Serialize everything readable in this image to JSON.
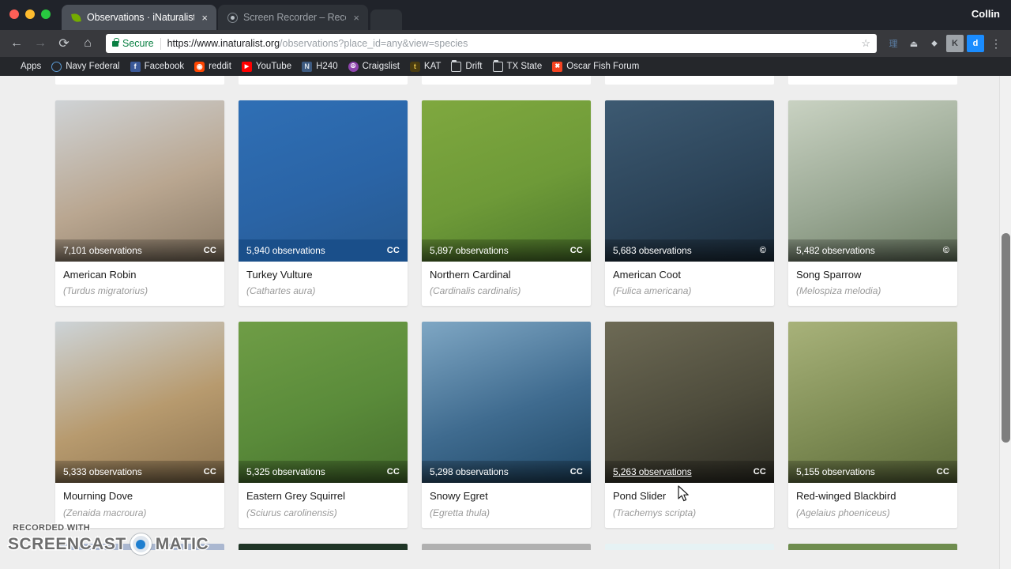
{
  "browser": {
    "tabs": [
      {
        "title": "Observations · iNaturalist.org",
        "favicon": "leaf-icon",
        "close": "×",
        "active": true
      },
      {
        "title": "Screen Recorder – Record you",
        "favicon": "record-icon",
        "close": "×",
        "active": false
      }
    ],
    "user": "Collin",
    "nav": {
      "back": "←",
      "forward": "→",
      "reload": "⟳",
      "home": "⌂"
    },
    "omnibox": {
      "security_label": "Secure",
      "url_scheme": "https://www.",
      "url_host": "inaturalist.org",
      "url_path": "/observations?place_id=any&view=species",
      "full_url": "https://www.inaturalist.org/observations?place_id=any&view=species",
      "star": "☆"
    },
    "extensions": [
      {
        "name": "grid-extension-icon",
        "glyph": "理"
      },
      {
        "name": "download-extension-icon",
        "glyph": "⏏"
      },
      {
        "name": "drop-extension-icon",
        "glyph": "⬥"
      },
      {
        "name": "k-extension-icon",
        "glyph": "K"
      },
      {
        "name": "d-extension-icon",
        "glyph": "d"
      }
    ],
    "menu_glyph": "⋮",
    "bookmarks": [
      {
        "label": "Apps",
        "icon": "apps-grid-icon"
      },
      {
        "label": "Navy Federal",
        "icon": "globe-icon"
      },
      {
        "label": "Facebook",
        "icon": "facebook-icon",
        "glyph": "f"
      },
      {
        "label": "reddit",
        "icon": "reddit-icon",
        "glyph": "◉"
      },
      {
        "label": "YouTube",
        "icon": "youtube-icon",
        "glyph": "▶"
      },
      {
        "label": "H240",
        "icon": "notion-icon",
        "glyph": "N"
      },
      {
        "label": "Craigslist",
        "icon": "craigslist-icon",
        "glyph": "☮"
      },
      {
        "label": "KAT",
        "icon": "kat-icon",
        "glyph": "t"
      },
      {
        "label": "Drift",
        "icon": "folder-icon"
      },
      {
        "label": "TX State",
        "icon": "folder-icon"
      },
      {
        "label": "Oscar Fish Forum",
        "icon": "joomla-icon",
        "glyph": "✖"
      }
    ]
  },
  "page": {
    "observations_suffix": "observations",
    "license_cc": "CC",
    "license_copyright": "©",
    "species": [
      {
        "common_name": "American Robin",
        "scientific_name": "(Turdus migratorius)",
        "observations": "7,101 observations",
        "license": "CC",
        "bar_style": "gradient",
        "photo_colors": [
          "#cfd3d6",
          "#b9a690",
          "#8a7a66"
        ],
        "hovered": false
      },
      {
        "common_name": "Turkey Vulture",
        "scientific_name": "(Cathartes aura)",
        "observations": "5,940 observations",
        "license": "CC",
        "bar_style": "flat-blue",
        "photo_colors": [
          "#2f6fb5",
          "#2a64a6",
          "#27598f"
        ],
        "hovered": false
      },
      {
        "common_name": "Northern Cardinal",
        "scientific_name": "(Cardinalis cardinalis)",
        "observations": "5,897 observations",
        "license": "CC",
        "bar_style": "gradient",
        "photo_colors": [
          "#7fa83f",
          "#6e9a38",
          "#4e7a2c"
        ],
        "hovered": false
      },
      {
        "common_name": "American Coot",
        "scientific_name": "(Fulica americana)",
        "observations": "5,683 observations",
        "license": "©",
        "bar_style": "gradient",
        "photo_colors": [
          "#3d5a72",
          "#2c4459",
          "#1d2f3f"
        ],
        "hovered": false
      },
      {
        "common_name": "Song Sparrow",
        "scientific_name": "(Melospiza melodia)",
        "observations": "5,482 observations",
        "license": "©",
        "bar_style": "gradient",
        "photo_colors": [
          "#c9d2c2",
          "#9aa894",
          "#6f7f66"
        ],
        "hovered": false
      },
      {
        "common_name": "Mourning Dove",
        "scientific_name": "(Zenaida macroura)",
        "observations": "5,333 observations",
        "license": "CC",
        "bar_style": "gradient",
        "photo_colors": [
          "#cdd4d8",
          "#b79a6e",
          "#8d7450"
        ],
        "hovered": false
      },
      {
        "common_name": "Eastern Grey Squirrel",
        "scientific_name": "(Sciurus carolinensis)",
        "observations": "5,325 observations",
        "license": "CC",
        "bar_style": "gradient",
        "photo_colors": [
          "#6f9d46",
          "#5a8b3a",
          "#47702d"
        ],
        "hovered": false
      },
      {
        "common_name": "Snowy Egret",
        "scientific_name": "(Egretta thula)",
        "observations": "5,298 observations",
        "license": "CC",
        "bar_style": "gradient",
        "photo_colors": [
          "#7fa7c4",
          "#3f6b8f",
          "#1f4766"
        ],
        "hovered": false
      },
      {
        "common_name": "Pond Slider",
        "scientific_name": "(Trachemys scripta)",
        "observations": "5,263 observations",
        "license": "CC",
        "bar_style": "gradient",
        "photo_colors": [
          "#6d6a55",
          "#4e4c3c",
          "#2e2d24"
        ],
        "hovered": true
      },
      {
        "common_name": "Red-winged Blackbird",
        "scientific_name": "(Agelaius phoeniceus)",
        "observations": "5,155 observations",
        "license": "CC",
        "bar_style": "gradient",
        "photo_colors": [
          "#a8b27a",
          "#7f8d55",
          "#5c6a3a"
        ],
        "hovered": false
      }
    ],
    "next_row_colors": [
      "#aab7d0",
      "#1f3526",
      "#b0b0b0",
      "#e6f2f4",
      "#6e8c4e"
    ]
  },
  "watermark": {
    "recorded_with": "RECORDED WITH",
    "word_left": "SCREENCAST",
    "word_right": "MATIC"
  }
}
